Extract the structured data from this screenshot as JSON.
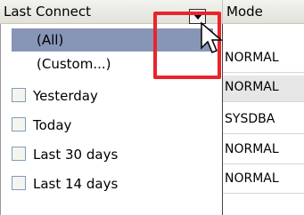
{
  "header": {
    "col1": "Last Connect",
    "col2": "Mode"
  },
  "dropdown": {
    "items": [
      {
        "label": "(All)",
        "type": "plain",
        "selected": true
      },
      {
        "label": "(Custom...)",
        "type": "plain",
        "selected": false
      },
      {
        "label": "Yesterday",
        "type": "checkbox",
        "checked": false
      },
      {
        "label": "Today",
        "type": "checkbox",
        "checked": false
      },
      {
        "label": "Last 30 days",
        "type": "checkbox",
        "checked": false
      },
      {
        "label": "Last 14 days",
        "type": "checkbox",
        "checked": false
      }
    ]
  },
  "mode_column": {
    "cells": [
      "NORMAL",
      "NORMAL",
      "SYSDBA",
      "NORMAL",
      "NORMAL"
    ]
  },
  "colors": {
    "selection": "#8795b7",
    "highlight_box": "#e8242c"
  }
}
